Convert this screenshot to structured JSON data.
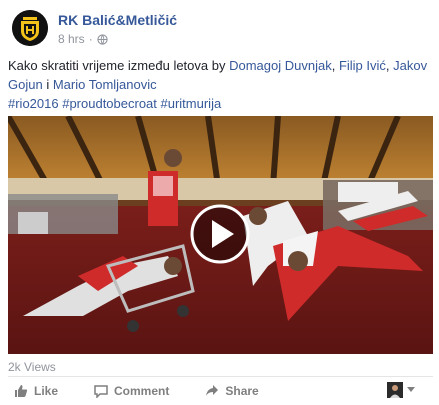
{
  "page": {
    "name": "RK Balić&Metličić",
    "time": "8 hrs",
    "separator": "·"
  },
  "post": {
    "text_before": "Kako skratiti vrijeme između letova by ",
    "people": [
      "Domagoj Duvnjak",
      "Filip Ivić",
      "Jakov Gojun",
      "Mario Tomljanovic"
    ],
    "sep1": ", ",
    "sep_and": " i ",
    "hashtags": "#rio2016 #proudtobecroat #uritmurija"
  },
  "video": {
    "views": "2k Views"
  },
  "actions": {
    "like": "Like",
    "comment": "Comment",
    "share": "Share"
  },
  "colors": {
    "link": "#365899",
    "text": "#1d2129",
    "muted": "#90949c",
    "action": "#7f7f7f"
  }
}
